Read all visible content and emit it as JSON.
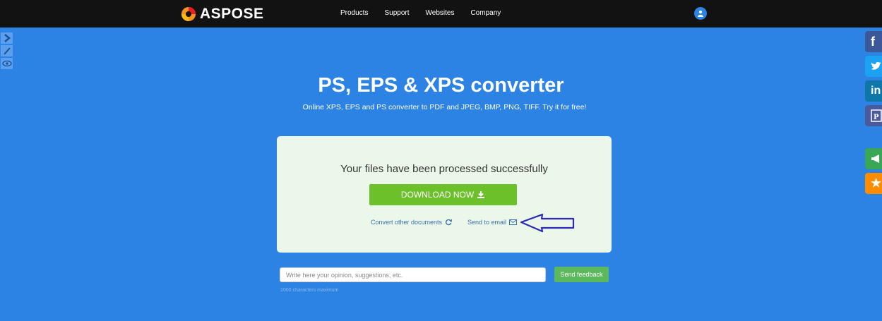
{
  "header": {
    "logo_text": "ASPOSE",
    "nav": [
      "Products",
      "Support",
      "Websites",
      "Company"
    ],
    "user_icon": "user-icon"
  },
  "left_tools": [
    "chevron-right-icon",
    "brush-icon",
    "eye-icon"
  ],
  "social": [
    {
      "icon": "facebook-icon",
      "color": "#3b5998",
      "glyph": "f"
    },
    {
      "icon": "twitter-icon",
      "color": "#1da1f2",
      "glyph": ""
    },
    {
      "icon": "linkedin-icon",
      "color": "#0e76a8",
      "glyph": "in"
    },
    {
      "icon": "product-icon",
      "color": "#4a5a9c",
      "glyph": ""
    },
    {
      "icon": "megaphone-icon",
      "color": "#3aa757",
      "glyph": ""
    },
    {
      "icon": "star-icon",
      "color": "#ff8c00",
      "glyph": "★"
    }
  ],
  "main": {
    "title": "PS, EPS & XPS converter",
    "subtitle": "Online XPS, EPS and PS converter to PDF and JPEG, BMP, PNG, TIFF. Try it for free!"
  },
  "result": {
    "message": "Your files have been processed successfully",
    "download_label": "DOWNLOAD NOW",
    "convert_other": "Convert other documents",
    "send_email": "Send to email"
  },
  "feedback": {
    "placeholder": "Write here your opinion, suggestions, etc.",
    "button": "Send feedback",
    "limit": "1000 characters maximum"
  },
  "colors": {
    "background": "#2c83e3",
    "topbar": "#121212",
    "download": "#6cc12a",
    "feedback_button": "#5cb85c"
  }
}
